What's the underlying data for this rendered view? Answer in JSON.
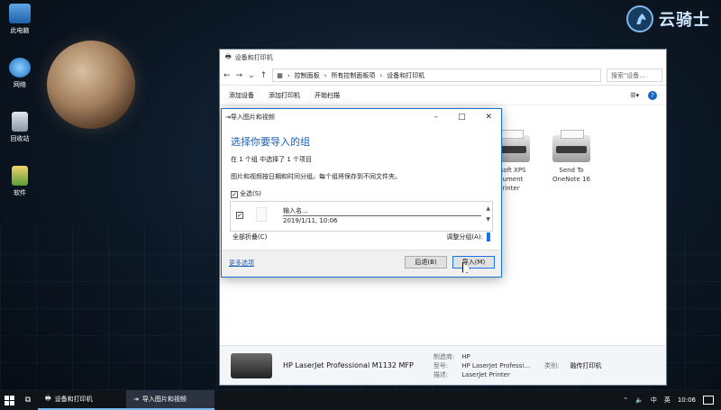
{
  "desktop": {
    "icons": [
      {
        "label": "此电脑",
        "icon": "computer-icon"
      },
      {
        "label": "网络",
        "icon": "network-icon"
      },
      {
        "label": "回收站",
        "icon": "recycle-bin-icon"
      },
      {
        "label": "软件",
        "icon": "software-folder-icon"
      }
    ],
    "brand": "云骑士"
  },
  "explorer": {
    "title": "设备和打印机",
    "breadcrumb": [
      "控制面板",
      "所有控制面板项",
      "设备和打印机"
    ],
    "search_placeholder": "搜索\"设备...",
    "commands": [
      "添加设备",
      "添加打印机",
      "开始扫描"
    ],
    "printers": [
      {
        "line1": "osoft XPS",
        "line2": "cument",
        "line3": "rinter"
      },
      {
        "line1": "Send To",
        "line2": "OneNote 16",
        "line3": ""
      }
    ],
    "details": {
      "model": "HP LaserJet Professional M1132 MFP",
      "rows": [
        {
          "key": "制造商:",
          "value": "HP"
        },
        {
          "key": "型号:",
          "value": "HP LaserJet Professi..."
        },
        {
          "key": "描述:",
          "value": "LaserJet Printer"
        }
      ],
      "category_key": "类别:",
      "category_value": "融传打印机"
    }
  },
  "dialog": {
    "title": "导入图片和视频",
    "heading": "选择你要导入的组",
    "summary": "在 1 个组 中选择了 1 个项目",
    "description": "图片和视频按日期和时间分组。每个组将保存到不同文件夹。",
    "select_all": "全选(S)",
    "group_name_placeholder": "输入名...",
    "group_date": "2019/1/11, 10:06",
    "expand_all": "全部折叠(C)",
    "adjust_groups": "调整分组(A):",
    "more_options": "更多选项",
    "back_button": "后退(B)",
    "import_button": "导入(M)"
  },
  "taskbar": {
    "apps": [
      {
        "label": "设备和打印机"
      },
      {
        "label": "导入图片和视频"
      }
    ],
    "ime": "中",
    "lang": "英",
    "time": "10:06"
  }
}
